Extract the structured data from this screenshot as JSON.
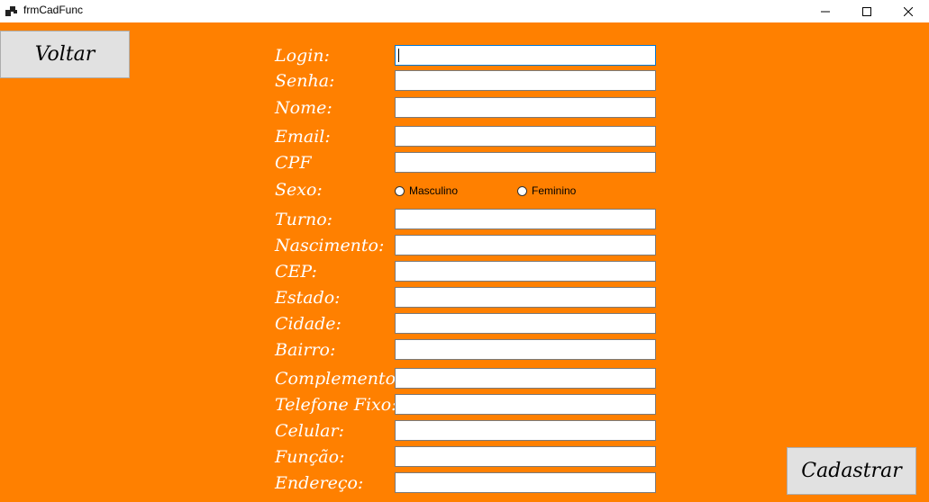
{
  "window": {
    "title": "frmCadFunc"
  },
  "buttons": {
    "voltar": "Voltar",
    "cadastrar": "Cadastrar"
  },
  "labels": {
    "login": "Login:",
    "senha": "Senha:",
    "nome": "Nome:",
    "email": "Email:",
    "cpf": "CPF",
    "sexo": "Sexo:",
    "turno": "Turno:",
    "nascimento": "Nascimento:",
    "cep": "CEP:",
    "estado": "Estado:",
    "cidade": "Cidade:",
    "bairro": "Bairro:",
    "complemento": "Complemento:",
    "telefone_fixo": "Telefone Fixo:",
    "celular": "Celular:",
    "funcao": "Função:",
    "endereco": "Endereço:"
  },
  "sexo_options": {
    "masculino": "Masculino",
    "feminino": "Feminino"
  },
  "colors": {
    "background": "#ff8000",
    "label_text": "#ffffff",
    "button_bg": "#e1e1e1"
  }
}
